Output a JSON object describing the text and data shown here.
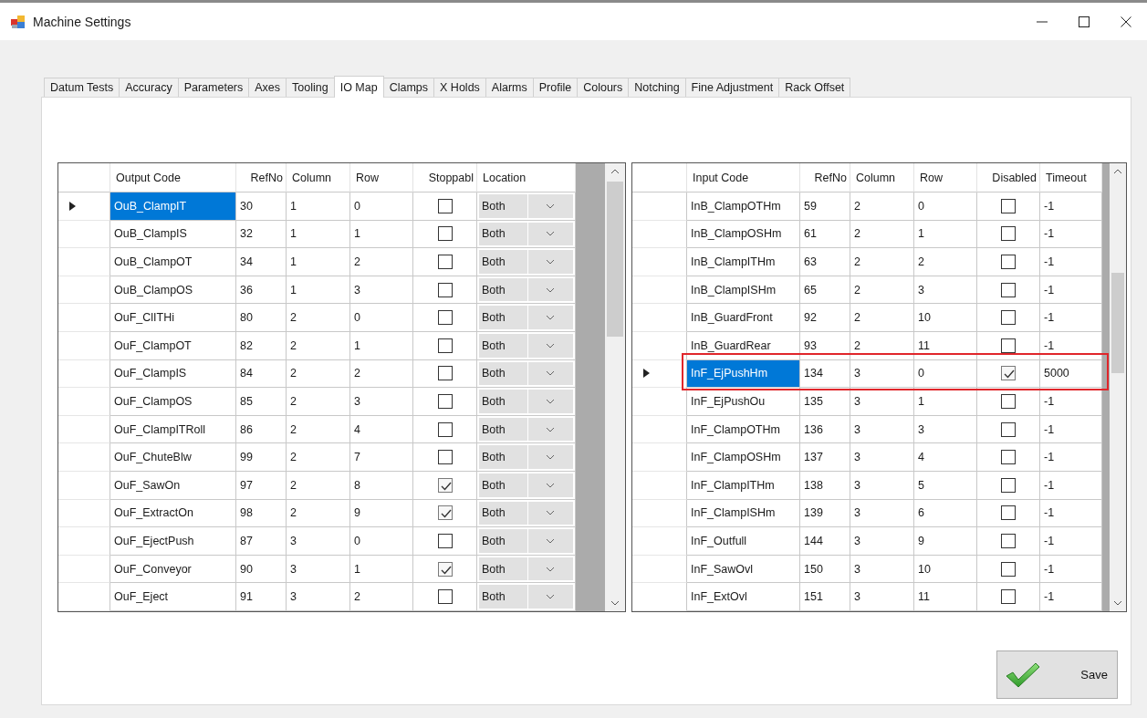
{
  "window": {
    "title": "Machine Settings"
  },
  "tabs": [
    {
      "label": "Datum Tests",
      "selected": false
    },
    {
      "label": "Accuracy",
      "selected": false
    },
    {
      "label": "Parameters",
      "selected": false
    },
    {
      "label": "Axes",
      "selected": false
    },
    {
      "label": "Tooling",
      "selected": false
    },
    {
      "label": "IO Map",
      "selected": true
    },
    {
      "label": "Clamps",
      "selected": false
    },
    {
      "label": "X Holds",
      "selected": false
    },
    {
      "label": "Alarms",
      "selected": false
    },
    {
      "label": "Profile",
      "selected": false
    },
    {
      "label": "Colours",
      "selected": false
    },
    {
      "label": "Notching",
      "selected": false
    },
    {
      "label": "Fine Adjustment",
      "selected": false
    },
    {
      "label": "Rack Offset",
      "selected": false
    }
  ],
  "outputs": {
    "columns": [
      "Output Code",
      "RefNo",
      "Column",
      "Row",
      "Stoppabl",
      "Location"
    ],
    "rows": [
      {
        "code": "OuB_ClampIT",
        "ref": "30",
        "column": "1",
        "row": "0",
        "stoppable": false,
        "location": "Both",
        "selected": true
      },
      {
        "code": "OuB_ClampIS",
        "ref": "32",
        "column": "1",
        "row": "1",
        "stoppable": false,
        "location": "Both",
        "selected": false
      },
      {
        "code": "OuB_ClampOT",
        "ref": "34",
        "column": "1",
        "row": "2",
        "stoppable": false,
        "location": "Both",
        "selected": false
      },
      {
        "code": "OuB_ClampOS",
        "ref": "36",
        "column": "1",
        "row": "3",
        "stoppable": false,
        "location": "Both",
        "selected": false
      },
      {
        "code": "OuF_ClITHi",
        "ref": "80",
        "column": "2",
        "row": "0",
        "stoppable": false,
        "location": "Both",
        "selected": false
      },
      {
        "code": "OuF_ClampOT",
        "ref": "82",
        "column": "2",
        "row": "1",
        "stoppable": false,
        "location": "Both",
        "selected": false
      },
      {
        "code": "OuF_ClampIS",
        "ref": "84",
        "column": "2",
        "row": "2",
        "stoppable": false,
        "location": "Both",
        "selected": false
      },
      {
        "code": "OuF_ClampOS",
        "ref": "85",
        "column": "2",
        "row": "3",
        "stoppable": false,
        "location": "Both",
        "selected": false
      },
      {
        "code": "OuF_ClampITRoll",
        "ref": "86",
        "column": "2",
        "row": "4",
        "stoppable": false,
        "location": "Both",
        "selected": false
      },
      {
        "code": "OuF_ChuteBlw",
        "ref": "99",
        "column": "2",
        "row": "7",
        "stoppable": false,
        "location": "Both",
        "selected": false
      },
      {
        "code": "OuF_SawOn",
        "ref": "97",
        "column": "2",
        "row": "8",
        "stoppable": true,
        "location": "Both",
        "selected": false
      },
      {
        "code": "OuF_ExtractOn",
        "ref": "98",
        "column": "2",
        "row": "9",
        "stoppable": true,
        "location": "Both",
        "selected": false
      },
      {
        "code": "OuF_EjectPush",
        "ref": "87",
        "column": "3",
        "row": "0",
        "stoppable": false,
        "location": "Both",
        "selected": false
      },
      {
        "code": "OuF_Conveyor",
        "ref": "90",
        "column": "3",
        "row": "1",
        "stoppable": true,
        "location": "Both",
        "selected": false
      },
      {
        "code": "OuF_Eject",
        "ref": "91",
        "column": "3",
        "row": "2",
        "stoppable": false,
        "location": "Both",
        "selected": false
      }
    ]
  },
  "inputs": {
    "columns": [
      "Input Code",
      "RefNo",
      "Column",
      "Row",
      "Disabled",
      "Timeout"
    ],
    "rows": [
      {
        "code": "InB_ClampOTHm",
        "ref": "59",
        "column": "2",
        "row": "0",
        "disabled": false,
        "timeout": "-1",
        "selected": false,
        "highlighted": false
      },
      {
        "code": "InB_ClampOSHm",
        "ref": "61",
        "column": "2",
        "row": "1",
        "disabled": false,
        "timeout": "-1",
        "selected": false,
        "highlighted": false
      },
      {
        "code": "InB_ClampITHm",
        "ref": "63",
        "column": "2",
        "row": "2",
        "disabled": false,
        "timeout": "-1",
        "selected": false,
        "highlighted": false
      },
      {
        "code": "InB_ClampISHm",
        "ref": "65",
        "column": "2",
        "row": "3",
        "disabled": false,
        "timeout": "-1",
        "selected": false,
        "highlighted": false
      },
      {
        "code": "InB_GuardFront",
        "ref": "92",
        "column": "2",
        "row": "10",
        "disabled": false,
        "timeout": "-1",
        "selected": false,
        "highlighted": false
      },
      {
        "code": "InB_GuardRear",
        "ref": "93",
        "column": "2",
        "row": "11",
        "disabled": false,
        "timeout": "-1",
        "selected": false,
        "highlighted": false
      },
      {
        "code": "InF_EjPushHm",
        "ref": "134",
        "column": "3",
        "row": "0",
        "disabled": true,
        "timeout": "5000",
        "selected": true,
        "highlighted": true
      },
      {
        "code": "InF_EjPushOu",
        "ref": "135",
        "column": "3",
        "row": "1",
        "disabled": false,
        "timeout": "-1",
        "selected": false,
        "highlighted": false
      },
      {
        "code": "InF_ClampOTHm",
        "ref": "136",
        "column": "3",
        "row": "3",
        "disabled": false,
        "timeout": "-1",
        "selected": false,
        "highlighted": false
      },
      {
        "code": "InF_ClampOSHm",
        "ref": "137",
        "column": "3",
        "row": "4",
        "disabled": false,
        "timeout": "-1",
        "selected": false,
        "highlighted": false
      },
      {
        "code": "InF_ClampITHm",
        "ref": "138",
        "column": "3",
        "row": "5",
        "disabled": false,
        "timeout": "-1",
        "selected": false,
        "highlighted": false
      },
      {
        "code": "InF_ClampISHm",
        "ref": "139",
        "column": "3",
        "row": "6",
        "disabled": false,
        "timeout": "-1",
        "selected": false,
        "highlighted": false
      },
      {
        "code": "InF_Outfull",
        "ref": "144",
        "column": "3",
        "row": "9",
        "disabled": false,
        "timeout": "-1",
        "selected": false,
        "highlighted": false
      },
      {
        "code": "InF_SawOvl",
        "ref": "150",
        "column": "3",
        "row": "10",
        "disabled": false,
        "timeout": "-1",
        "selected": false,
        "highlighted": false
      },
      {
        "code": "InF_ExtOvl",
        "ref": "151",
        "column": "3",
        "row": "11",
        "disabled": false,
        "timeout": "-1",
        "selected": false,
        "highlighted": false
      }
    ]
  },
  "save_button": {
    "label": "Save"
  }
}
